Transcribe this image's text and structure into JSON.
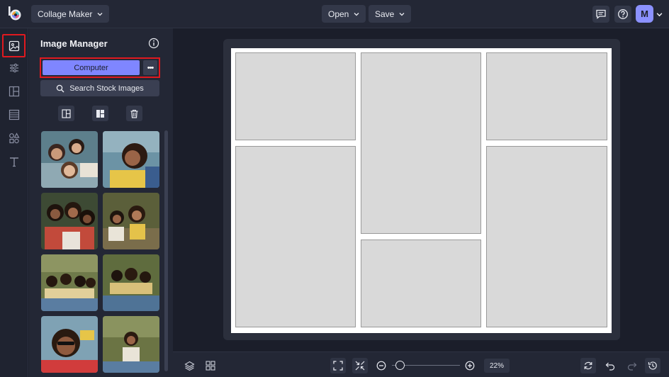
{
  "topbar": {
    "app_menu": "Collage Maker",
    "open_label": "Open",
    "save_label": "Save",
    "avatar_initial": "M"
  },
  "panel": {
    "title": "Image Manager",
    "computer_label": "Computer",
    "more_label": "•••",
    "stock_label": "Search Stock Images"
  },
  "zoom": {
    "level_label": "22%",
    "slider_fraction": 0.12
  },
  "colors": {
    "accent": "#7f86ff",
    "highlight": "#e0191f",
    "cell_fill": "#d9d9d9"
  }
}
